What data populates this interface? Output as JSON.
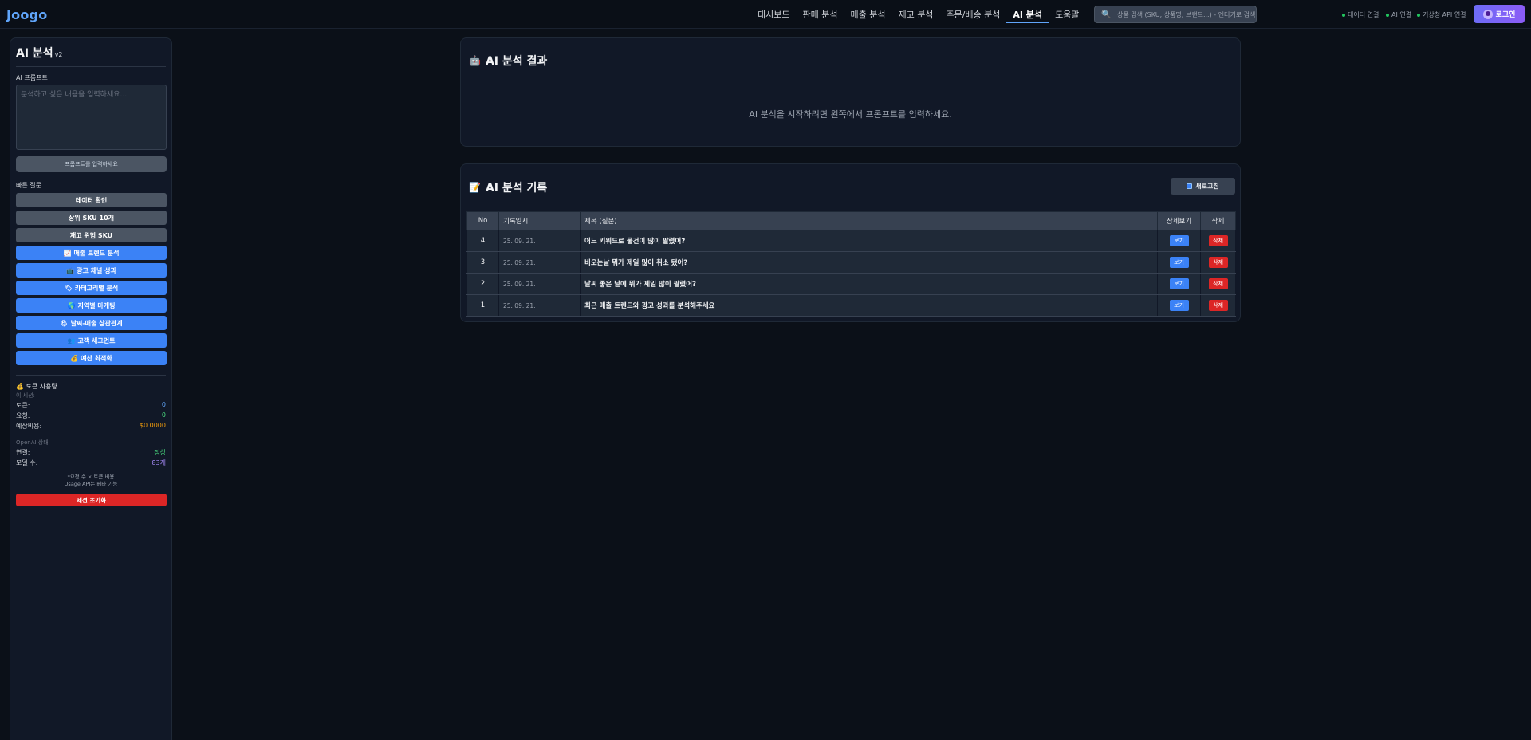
{
  "app": {
    "logo": "Joogo"
  },
  "nav": {
    "items": [
      {
        "label": "대시보드",
        "active": false
      },
      {
        "label": "판매 분석",
        "active": false
      },
      {
        "label": "매출 분석",
        "active": false
      },
      {
        "label": "재고 분석",
        "active": false
      },
      {
        "label": "주문/배송 분석",
        "active": false
      },
      {
        "label": "AI 분석",
        "active": true
      },
      {
        "label": "도움말",
        "active": false
      }
    ]
  },
  "search": {
    "placeholder": "상품 검색 (SKU, 상품명, 브랜드...) - 엔터키로 검색"
  },
  "status": {
    "data": "데이터 연결",
    "ai": "AI 연결",
    "weather": "기상청 API 연결"
  },
  "login": {
    "label": "로그인"
  },
  "sidebar": {
    "title": "AI 분석",
    "version": "v2",
    "prompt_label": "AI 프롬프트",
    "prompt_placeholder": "분석하고 싶은 내용을 입력하세요...",
    "prompt_value": "",
    "submit_label": "프롬프트를 입력하세요",
    "quick_label": "빠른 질문",
    "quick": [
      {
        "label": "데이터 확인",
        "emoji": "",
        "style": "gray"
      },
      {
        "label": "상위 SKU 10개",
        "emoji": "",
        "style": "gray"
      },
      {
        "label": "재고 위험 SKU",
        "emoji": "",
        "style": "gray"
      },
      {
        "label": "매출 트렌드 분석",
        "emoji": "📈",
        "style": "blue"
      },
      {
        "label": "광고 채널 성과",
        "emoji": "📺",
        "style": "blue"
      },
      {
        "label": "카테고리별 분석",
        "emoji": "🏷",
        "style": "blue"
      },
      {
        "label": "지역별 마케팅",
        "emoji": "🌎",
        "style": "blue"
      },
      {
        "label": "날씨-매출 상관관계",
        "emoji": "🌦",
        "style": "blue"
      },
      {
        "label": "고객 세그먼트",
        "emoji": "👥",
        "style": "blue"
      },
      {
        "label": "예산 최적화",
        "emoji": "💰",
        "style": "blue"
      }
    ],
    "token": {
      "title": "토큰 사용량",
      "emoji": "💰",
      "session_label": "이 세션:",
      "rows": [
        {
          "label": "토큰:",
          "value": "0",
          "color": "blue"
        },
        {
          "label": "요청:",
          "value": "0",
          "color": "green"
        },
        {
          "label": "예상비용:",
          "value": "$0.0000",
          "color": "orange"
        }
      ],
      "openai_label": "OpenAI 상태",
      "openai_rows": [
        {
          "label": "연결:",
          "value": "정상",
          "color": "green"
        },
        {
          "label": "모델 수:",
          "value": "83개",
          "color": "purple"
        }
      ],
      "note1": "*요청 수 × 토큰 비용",
      "note2": "Usage API는 베타 기능",
      "reset_label": "세션 초기화"
    }
  },
  "result": {
    "title": "AI 분석 결과",
    "emoji": "🤖",
    "empty": "AI 분석을 시작하려면 왼쪽에서 프롬프트를 입력하세요."
  },
  "history": {
    "title": "AI 분석 기록",
    "emoji": "📝",
    "refresh_label": "새로고침",
    "columns": [
      "No",
      "기록일시",
      "제목 (질문)",
      "상세보기",
      "삭제"
    ],
    "rows": [
      {
        "no": "4",
        "date": "25. 09. 21.",
        "title": "어느 키워드로 물건이 많이 팔렸어?",
        "view": "보기",
        "del": "삭제"
      },
      {
        "no": "3",
        "date": "25. 09. 21.",
        "title": "비오는날 뭐가 제일 많이 취소 됐어?",
        "view": "보기",
        "del": "삭제"
      },
      {
        "no": "2",
        "date": "25. 09. 21.",
        "title": "날씨 좋은 날에 뭐가 제일 많이 팔렸어?",
        "view": "보기",
        "del": "삭제"
      },
      {
        "no": "1",
        "date": "25. 09. 21.",
        "title": "최근 매출 트렌드와 광고 성과를 분석해주세요",
        "view": "보기",
        "del": "삭제"
      }
    ]
  },
  "colors": {
    "accent": "#3b82f6",
    "danger": "#dc2626",
    "background": "#0b1018",
    "panel": "#111827"
  }
}
